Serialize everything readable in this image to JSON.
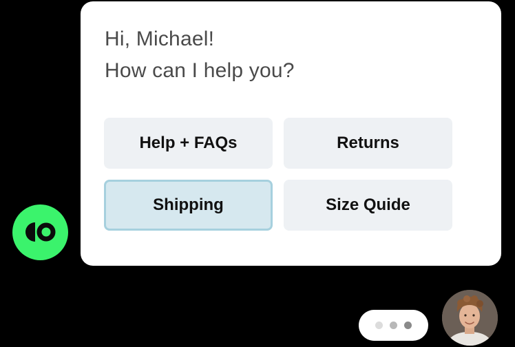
{
  "greeting": {
    "line1": "Hi, Michael!",
    "line2": "How can I help you?"
  },
  "options": [
    {
      "label": "Help + FAQs",
      "selected": false
    },
    {
      "label": "Returns",
      "selected": false
    },
    {
      "label": "Shipping",
      "selected": true
    },
    {
      "label": "Size Quide",
      "selected": false
    }
  ],
  "brand": {
    "icon": "brand-logo-icon",
    "color": "#3bf36c"
  },
  "typing_indicator": {
    "dots": 3
  },
  "user": {
    "avatar": "user-avatar-photo"
  },
  "colors": {
    "background": "#000000",
    "card": "#ffffff",
    "option_bg": "#eef1f4",
    "option_selected_bg": "#d6e8ef",
    "option_selected_border": "#a6d0de",
    "brand_green": "#3bf36c"
  }
}
